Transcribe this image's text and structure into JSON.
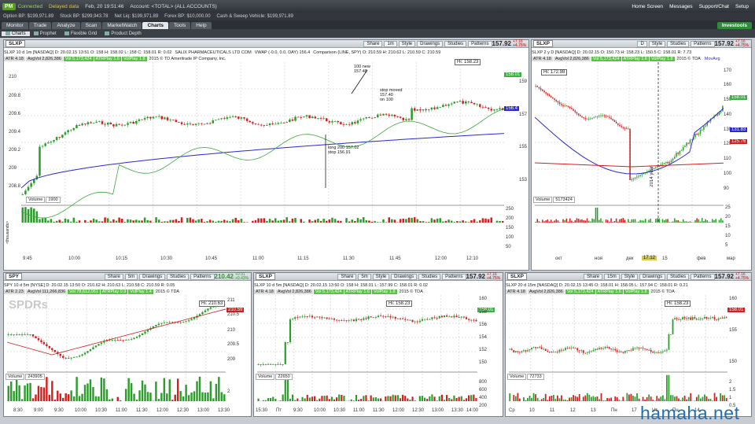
{
  "app": {
    "logo": "PM",
    "status": "Connected",
    "feed": "Delayed data",
    "date": "Feb, 20 19:51:46",
    "account": "Account: <TOTAL> (ALL ACCOUNTS)",
    "links": [
      "Home Screen",
      "Messages",
      "Support/Chat",
      "Setup"
    ]
  },
  "account_bar": [
    "Option BP: $199,971.89",
    "Stock BP: $299,943.78",
    "Net Liq: $199,971.89",
    "Forex BP: $10,000.00",
    "Cash & Sweep Vehicle: $199,971.89"
  ],
  "tabs": [
    "Monitor",
    "Trade",
    "Analyze",
    "Scan",
    "MarketWatch",
    "Charts",
    "Tools",
    "Help"
  ],
  "active_tab": "Charts",
  "brand": "Investools",
  "subtabs": [
    "Charts",
    "Prophet",
    "Flexible Grid",
    "Product Depth"
  ],
  "colors": {
    "up": "#2a9d2a",
    "down": "#d02020",
    "green_tag": "#3cb043",
    "blue_line": "#2a2ad0",
    "brand_green": "#2f8a3a"
  },
  "panel_buttons": [
    "Share",
    "Style",
    "Drawings",
    "Studies",
    "Patterns"
  ],
  "panels": {
    "main": {
      "symbol": "SLXP",
      "price": "157.92",
      "chg": "+7.16 +4.75%",
      "interval": "1m",
      "info": "SLXP 10 d 1m [NASDAQ]  D: 20.02.15 13:51  O: 158  H: 158.02  L: 158  C: 158.01  R: 0.02",
      "company": "SALIX PHARMACEUTICALS LTD COM",
      "studies_line": "VWAP (-0.0, 0.0, DAY)  156.4",
      "comparison": "Comparison (LINE, SPY)  O: 210.59  H: 210.62  L: 210.59  C: 210.59",
      "atr": "ATR 4.18",
      "avgvol": "AvgVol 2,826,386",
      "vol": "Vol 5,173,424",
      "atrplay": "ATRPlay 1.6",
      "volplay": "VolPlay 1.8",
      "copyright": "2015 © TD Ameritrade IP Company, Inc.",
      "hi": "Hi: 158.23",
      "y_ticks": [
        "210",
        "209.8",
        "209.6",
        "209.4",
        "209.2",
        "209",
        "208.8"
      ],
      "y_ticks_right": [
        "159",
        "157",
        "155",
        "153"
      ],
      "tags": {
        "green": "158.01",
        "blue": "156.4"
      },
      "x_ticks": [
        "9:45",
        "10:00",
        "10:15",
        "10:30",
        "10:45",
        "11:00",
        "11:15",
        "11:30",
        "11:45",
        "12:00",
        "12:10"
      ],
      "volume_label": "Volume",
      "volume_value": "1900",
      "vol_ticks": [
        "250",
        "200",
        "150",
        "100",
        "50"
      ],
      "vol_axis": "<thousands>",
      "notes": {
        "a": [
          "100 new",
          "157.48"
        ],
        "b": [
          "stop moved",
          "157.40",
          "on 100"
        ],
        "c": [
          "long 200 157.02",
          "stop 156.91"
        ]
      }
    },
    "daily": {
      "symbol": "SLXP",
      "price": "157.92",
      "chg": "+7.16 +4.75%",
      "interval": "D",
      "info": "SLXP 2 y D [NASDAQ]  D: 20.02.15  O: 150.73  H: 158.23  L: 150.5  C: 158.01  R: 7.73",
      "movavg": "MovAvg",
      "copyright": "2015 © TDA",
      "hi": "Hi: 172.98",
      "y_ticks": [
        "170",
        "160",
        "150",
        "140",
        "130",
        "120",
        "110",
        "100",
        "90"
      ],
      "tags": [
        "158.01",
        "131.83",
        "125.76"
      ],
      "x_ticks": [
        "окт",
        "ноя",
        "дек",
        "15",
        "фев",
        "мар"
      ],
      "x_highlight": "17.12",
      "year_label": "2014 year",
      "volume_value": "5173424",
      "vol_ticks": [
        "25",
        "20",
        "15",
        "10",
        "5"
      ]
    },
    "spy": {
      "symbol": "SPY",
      "price": "210.42",
      "chg": "+0.91 +0.43%",
      "interval": "5m",
      "info": "SPY 10 d 5m [NYSE]  D: 20.02.15 13:50  O: 210.62  H: 210.63  L: 210.58  C: 210.59  R: 0.05",
      "atr": "ATR 2.23",
      "avgvol": "AvgVol 111,266,836",
      "vol": "Vol 78,612,061",
      "atrplay": "ATRPlay 0.9",
      "volplay": "VolPlay 1.4",
      "copyright": "2015 © TDA",
      "watermark": "SPDRs",
      "hi": "Hi: 210.63",
      "y_ticks": [
        "211",
        "210.5",
        "210",
        "209.5",
        "209"
      ],
      "tag": "210.59",
      "x_ticks": [
        "8:30",
        "9:00",
        "9:30",
        "10:00",
        "10:30",
        "11:00",
        "11:30",
        "12:00",
        "12:30",
        "13:00",
        "13:30"
      ],
      "volume_value": "243905",
      "vol_ticks": [
        "2"
      ]
    },
    "slxp5m": {
      "symbol": "SLXP",
      "price": "157.92",
      "chg": "+7.16 +4.75%",
      "interval": "5m",
      "info": "SLXP 10 d 5m [NASDAQ]  D: 20.02.15 13:50  O: 158  H: 158.01  L: 157.99  C: 158.01  R: 0.02",
      "atr": "ATR 4.18",
      "avgvol": "AvgVol 2,826,386",
      "vol": "Vol 5,173,424",
      "atrplay": "ATRPlay 1.6",
      "volplay": "VolPlay 1.8",
      "copyright": "2015 © TDA",
      "hi": "Hi: 158.23",
      "y_ticks": [
        "160",
        "158",
        "156",
        "154",
        "152",
        "150"
      ],
      "tag": "158.01",
      "x_ticks": [
        "15:30",
        "Пт",
        "9:30",
        "10:00",
        "10:30",
        "11:00",
        "11:30",
        "12:00",
        "12:30",
        "13:00",
        "13:30",
        "14:00"
      ],
      "volume_value": "22650",
      "vol_ticks": [
        "800",
        "600",
        "400",
        "200"
      ]
    },
    "slxp15m": {
      "symbol": "SLXP",
      "price": "157.92",
      "chg": "+7.16 +4.75%",
      "interval": "15m",
      "info": "SLXP 20 d 15m [NASDAQ]  D: 20.02.15 13:45  O: 158.01  H: 158.05  L: 157.94  C: 158.01  R: 0.21",
      "atr": "ATR 4.18",
      "avgvol": "AvgVol 2,826,386",
      "vol": "Vol 5,173,424",
      "atrplay": "ATRPlay 1.6",
      "volplay": "VolPlay 1.8",
      "copyright": "2015 © TDA",
      "hi": "Hi: 158.23",
      "y_ticks": [
        "160",
        "155",
        "150"
      ],
      "tag": "158.01",
      "x_ticks": [
        "Ср",
        "10",
        "11",
        "12",
        "13",
        "Пн",
        "17",
        "Чт",
        "Пн",
        "14"
      ],
      "volume_value": "72733",
      "vol_ticks": [
        "2",
        "1.5",
        "1",
        "0.5"
      ]
    }
  },
  "watermark_site": "hamaha.net"
}
